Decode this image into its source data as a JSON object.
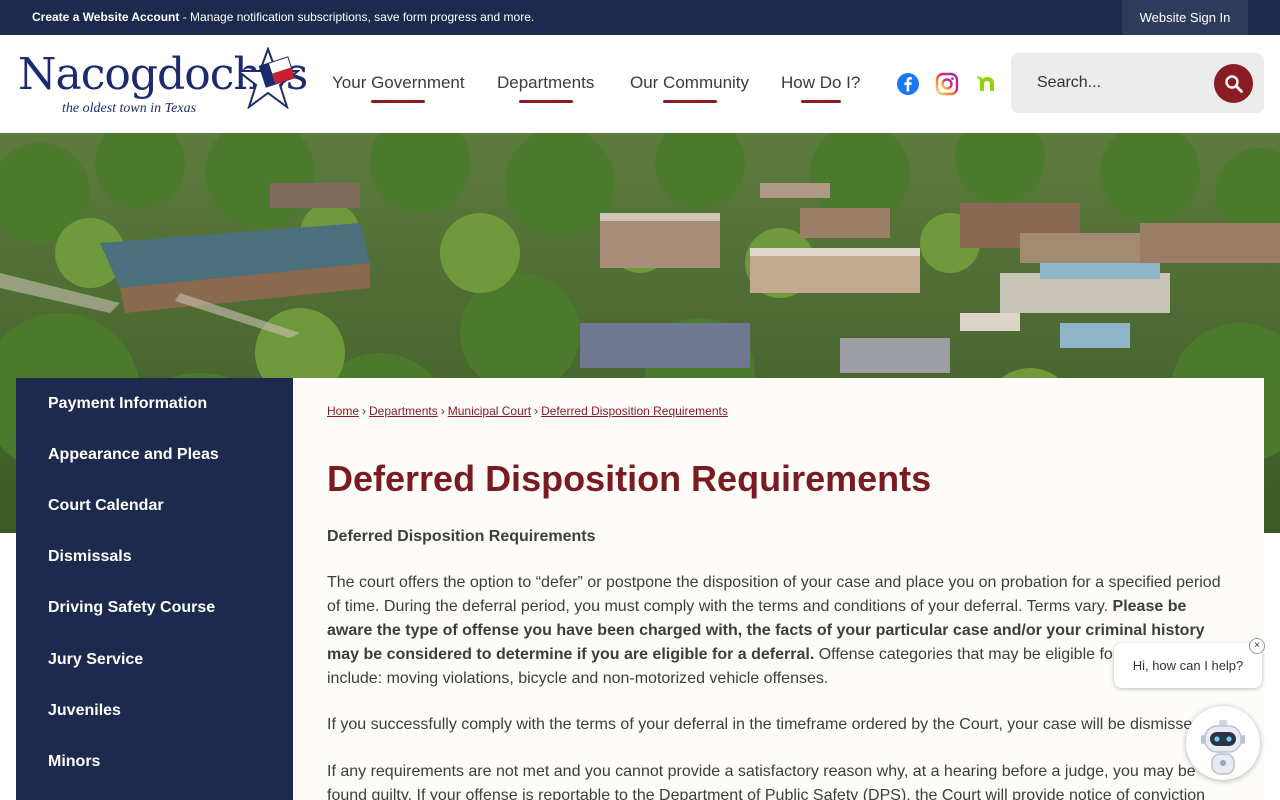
{
  "topbar": {
    "promo_bold": "Create a Website Account",
    "promo_text": " - Manage notification subscriptions, save form progress and more.",
    "signin_label": "Website Sign In"
  },
  "logo": {
    "wordmark": "Nacogdoches",
    "tagline": "the oldest town in Texas"
  },
  "nav": {
    "items": [
      {
        "label": "Your Government"
      },
      {
        "label": "Departments"
      },
      {
        "label": "Our Community"
      },
      {
        "label": "How Do I?"
      }
    ]
  },
  "social": {
    "icons": [
      "facebook-icon",
      "instagram-icon",
      "nextdoor-icon"
    ]
  },
  "search": {
    "placeholder": "Search..."
  },
  "colors": {
    "navy": "#1d2a4e",
    "brand_red": "#8a1c24",
    "title_red": "#7a1b22"
  },
  "sidebar": {
    "items": [
      {
        "label": "Payment Information"
      },
      {
        "label": "Appearance and Pleas"
      },
      {
        "label": "Court Calendar"
      },
      {
        "label": "Dismissals"
      },
      {
        "label": "Driving Safety Course"
      },
      {
        "label": "Jury Service"
      },
      {
        "label": "Juveniles"
      },
      {
        "label": "Minors"
      }
    ]
  },
  "breadcrumb": {
    "items": [
      "Home",
      "Departments",
      "Municipal Court",
      "Deferred Disposition Requirements"
    ]
  },
  "main": {
    "title": "Deferred Disposition Requirements",
    "subhead": "Deferred Disposition Requirements",
    "p1_a": "The court offers the option to “defer” or postpone the disposition of your case and place you on probation for a specified period of time.  During the deferral period, you must comply with the terms and conditions of your deferral.  Terms vary. ",
    "p1_bold": "Please be aware the type of offense you have been charged with, the facts of your particular case and/or your criminal history may be considered to determine if you are eligible for a deferral.",
    "p1_b": " Offense categories that may be eligible for this option include: moving violations, bicycle and non-motorized vehicle offenses.",
    "p2": "If you successfully comply with the terms of your deferral in the timeframe ordered by the Court, your case will be dismissed.",
    "p3": "If any requirements are not met and you cannot provide a satisfactory reason why, at a hearing before a judge, you may be found guilty. If your offense is reportable to the Department of Public Safety (DPS), the Court will provide notice of conviction"
  },
  "chat": {
    "greeting": "Hi, how can I help?",
    "close_glyph": "×"
  }
}
